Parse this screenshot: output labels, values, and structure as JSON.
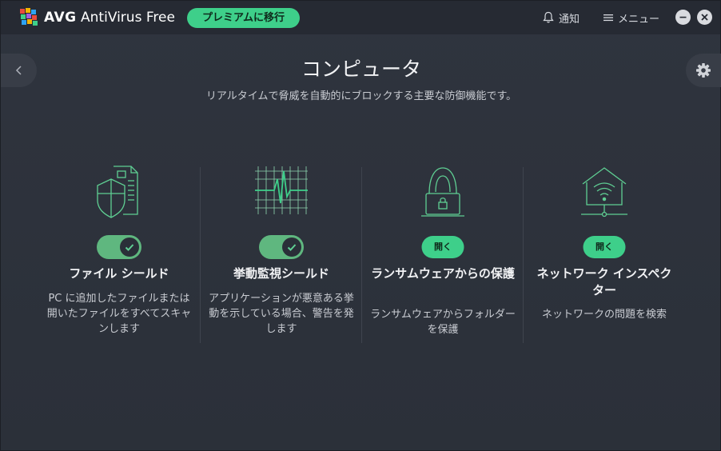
{
  "titlebar": {
    "brand_bold": "AVG",
    "brand_rest": " AntiVirus Free",
    "premium_label": "プレミアムに移行",
    "notify_label": "通知",
    "menu_label": "メニュー"
  },
  "page": {
    "title": "コンピュータ",
    "subtitle": "リアルタイムで脅威を自動的にブロックする主要な防御機能です。"
  },
  "features": [
    {
      "name": "ファイル シールド",
      "desc": "PC に追加したファイルまたは開いたファイルをすべてスキャンします",
      "control": "toggle",
      "enabled": true
    },
    {
      "name": "挙動監視シールド",
      "desc": "アプリケーションが悪意ある挙動を示している場合、警告を発します",
      "control": "toggle",
      "enabled": true
    },
    {
      "name": "ランサムウェアからの保護",
      "desc": "ランサムウェアからフォルダーを保護",
      "control": "button",
      "button_label": "開く"
    },
    {
      "name": "ネットワーク インスペクター",
      "desc": "ネットワークの問題を検索",
      "control": "button",
      "button_label": "開く"
    }
  ],
  "colors": {
    "accent_green": "#3ecf8a",
    "toggle_green": "#5fb77f",
    "background": "#2c313b",
    "icon_stroke": "#5fcf93"
  }
}
